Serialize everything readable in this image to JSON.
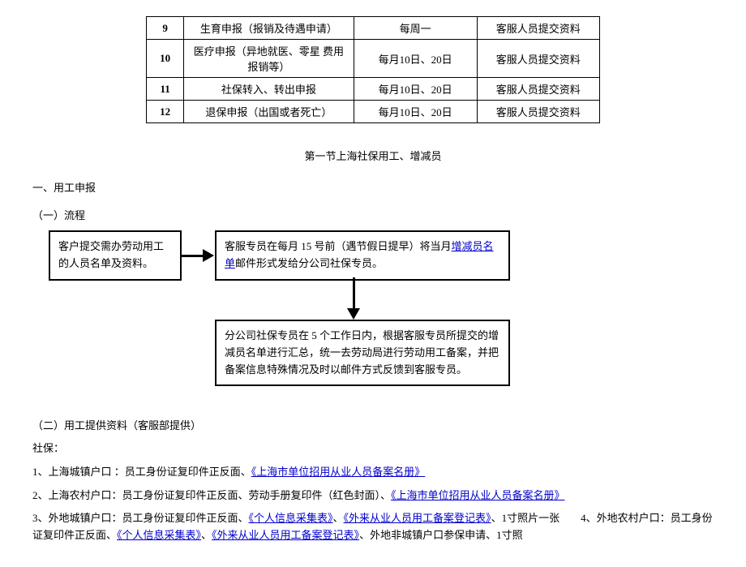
{
  "table": {
    "rows": [
      {
        "num": "9",
        "desc": "生育申报（报销及待遇申请）",
        "date": "每周一",
        "who": "客服人员提交资料"
      },
      {
        "num": "10",
        "desc": "医疗申报（异地就医、零星 费用报销等）",
        "date": "每月10日、20日",
        "who": "客服人员提交资料"
      },
      {
        "num": "11",
        "desc": "社保转入、转出申报",
        "date": "每月10日、20日",
        "who": "客服人员提交资料"
      },
      {
        "num": "12",
        "desc": "退保申报（出国或者死亡）",
        "date": "每月10日、20日",
        "who": "客服人员提交资料"
      }
    ]
  },
  "section_title": "第一节上海社保用工、增减员",
  "heading1": "一、用工申报",
  "heading2a": "（一）流程",
  "flow": {
    "box1": "客户提交需办劳动用工的人员名单及资料。",
    "box2_pre": "客服专员在每月 15 号前（遇节假日提早）将当月",
    "box2_link": "增减员名单",
    "box2_post": "邮件形式发给分公司社保专员。",
    "box3": "分公司社保专员在 5 个工作日内，根据客服专员所提交的增减员名单进行汇总，统一去劳动局进行劳动用工备案，并把备案信息特殊情况及时以邮件方式反馈到客服专员。"
  },
  "heading2b": "（二）用工提供资料（客服部提供）",
  "shebao_label": "社保：",
  "materials": {
    "m1_pre": "1、上海城镇户口 ：员工身份证复印件正反面、",
    "m1_link": "《上海市单位招用从业人员备案名册》",
    "m2_pre": "2、上海农村户口：员工身份证复印件正反面、劳动手册复印件（红色封面）、",
    "m2_link": "《上海市单位招用从业人员备案名册》",
    "m3_pre": "3、外地城镇户口：员工身份证复印件正反面、",
    "m3_link1": "《个人信息采集表》",
    "m3_mid1": "、",
    "m3_link2": "《外来从业人员用工备案登记表》",
    "m3_post": "、1寸照片一张　　4、外地农村户口：员工身份证复印件正反面、",
    "m3_link3": "《个人信息采集表》",
    "m3_mid2": "、",
    "m3_link4": "《外来从业人员用工备案登记表》",
    "m3_end": "、外地非城镇户口参保申请、1寸照"
  }
}
